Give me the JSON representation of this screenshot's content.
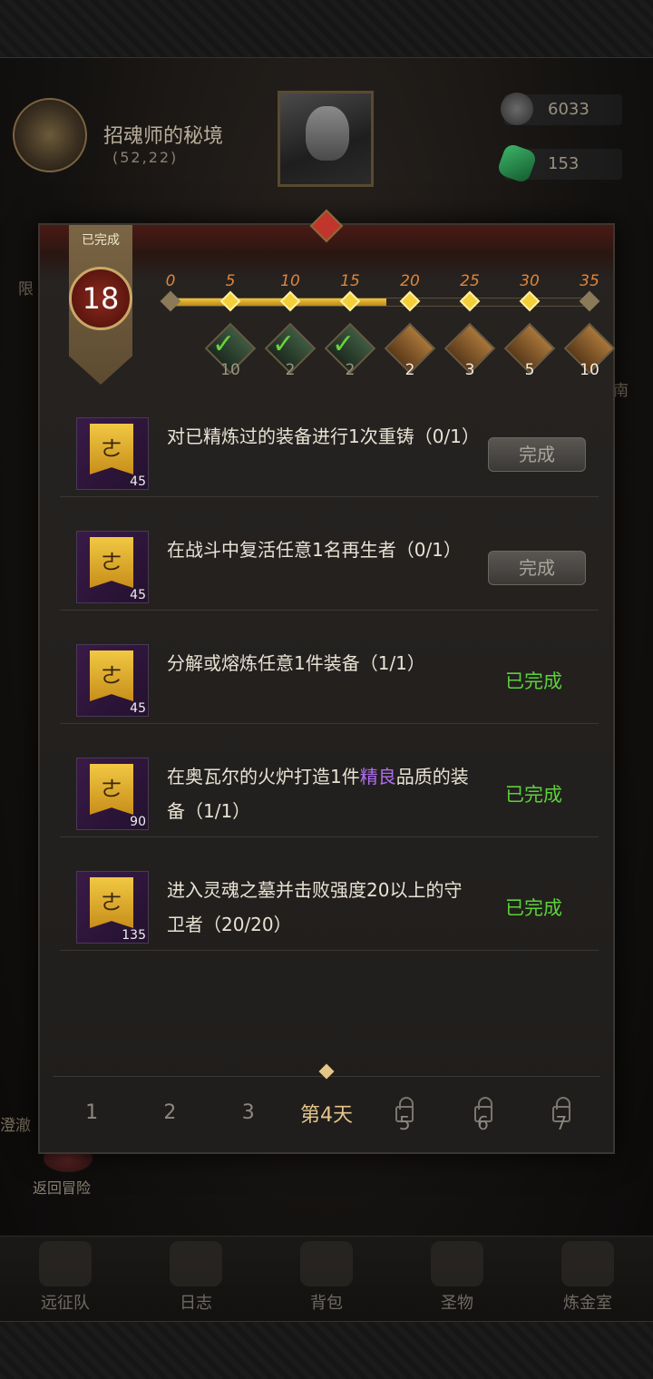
{
  "header": {
    "zone_name": "招魂师的秘境",
    "zone_coords": "(52,22)",
    "resources": [
      {
        "name": "stone",
        "value": "6033"
      },
      {
        "name": "gem",
        "value": "153"
      }
    ],
    "side_texts": [
      "限",
      "南",
      "澄澈"
    ]
  },
  "modal": {
    "banner_label": "已完成",
    "score": "18",
    "track": {
      "labels": [
        "0",
        "5",
        "10",
        "15",
        "20",
        "25",
        "30",
        "35"
      ],
      "progress": 18,
      "max": 35
    },
    "rewards": [
      {
        "count": "10",
        "claimed": true
      },
      {
        "count": "2",
        "claimed": true
      },
      {
        "count": "2",
        "claimed": true
      },
      {
        "count": "2",
        "claimed": false
      },
      {
        "count": "3",
        "claimed": false
      },
      {
        "count": "5",
        "claimed": false
      },
      {
        "count": "10",
        "claimed": false
      }
    ],
    "tasks": [
      {
        "text_pre": "对已精炼过的装备进行1次重铸（0/1）",
        "text_hl": "",
        "text_post": "",
        "points": "45",
        "status": "button",
        "action_label": "完成"
      },
      {
        "text_pre": "在战斗中复活任意1名再生者（0/1）",
        "text_hl": "",
        "text_post": "",
        "points": "45",
        "status": "button",
        "action_label": "完成"
      },
      {
        "text_pre": "分解或熔炼任意1件装备（1/1）",
        "text_hl": "",
        "text_post": "",
        "points": "45",
        "status": "done",
        "action_label": "已完成"
      },
      {
        "text_pre": "在奥瓦尔的火炉打造1件",
        "text_hl": "精良",
        "text_post": "品质的装备（1/1）",
        "points": "90",
        "status": "done",
        "action_label": "已完成"
      },
      {
        "text_pre": "进入灵魂之墓并击败强度20以上的守卫者（20/20）",
        "text_hl": "",
        "text_post": "",
        "points": "135",
        "status": "done",
        "action_label": "已完成"
      }
    ],
    "tabs": [
      {
        "label": "1",
        "locked": false
      },
      {
        "label": "2",
        "locked": false
      },
      {
        "label": "3",
        "locked": false
      },
      {
        "label": "第4天",
        "locked": false,
        "active": true
      },
      {
        "label": "5",
        "locked": true
      },
      {
        "label": "6",
        "locked": true
      },
      {
        "label": "7",
        "locked": true
      }
    ]
  },
  "back_label": "返回冒险",
  "bottom_nav": [
    {
      "label": "远征队",
      "icon": "helmet-icon"
    },
    {
      "label": "日志",
      "icon": "journal-icon"
    },
    {
      "label": "背包",
      "icon": "bag-icon"
    },
    {
      "label": "圣物",
      "icon": "relic-icon"
    },
    {
      "label": "炼金室",
      "icon": "alchemy-icon"
    }
  ]
}
